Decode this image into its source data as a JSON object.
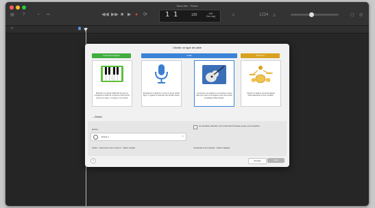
{
  "window": {
    "title": "Sans titre - Pistes"
  },
  "toolbar": {
    "left_buttons": [
      "library-icon",
      "help-icon",
      "smart-controls-icon"
    ],
    "transport": [
      "rewind-icon",
      "forward-icon",
      "stop-icon",
      "play-icon",
      "record-icon",
      "cycle-icon"
    ],
    "lcd": {
      "position": "1  1",
      "tempo": "120",
      "sig_top": "4/4",
      "sig_bottom": "Do maj"
    },
    "right_buttons": [
      "tuner-icon",
      "count-in-icon"
    ],
    "master_volume": 0.5
  },
  "dialog": {
    "title": "Choisir un type de piste",
    "tabs": [
      {
        "label": "Instrument logiciel",
        "color": "#3fae3f"
      },
      {
        "label": "Audio",
        "color": "#3a83d6"
      },
      {
        "label": "Drummer",
        "color": "#d9a21e"
      }
    ],
    "cards": [
      {
        "icon": "piano-keyboard-icon",
        "desc": "Branchez un clavier MIDI afin de jouer et enregistrer à l'aide de nombreux instruments, comme un piano, un orgue ou un synthé."
      },
      {
        "icon": "microphone-icon",
        "desc": "Enregistrez à l'aide d'un micro ou d'une entrée ligne, ou glissez et déposez des fichiers audio."
      },
      {
        "icon": "guitar-icon",
        "desc": "Connectez une guitare ou une basse à votre Mac pour jouer et enregistrer avec des amplis et pédales d'effet virtuels."
      },
      {
        "icon": "drummer-icon",
        "desc": "Ajoutez un batteur qui accompagne automatiquement votre musique."
      }
    ],
    "details_label": "Détails",
    "input_label": "Entrée :",
    "input_value": "Entrée 1",
    "monitor_text": "Je souhaite entendre mon instrument lorsque je joue et j'enregistre.",
    "output_text": "Sortie : Instrument sur le micro 1 : Micro intégré",
    "monitor_source": "J'entends le son depuis : Sortie intégrée",
    "help_label": "?",
    "cancel_label": "Annuler",
    "create_label": "Créer"
  }
}
